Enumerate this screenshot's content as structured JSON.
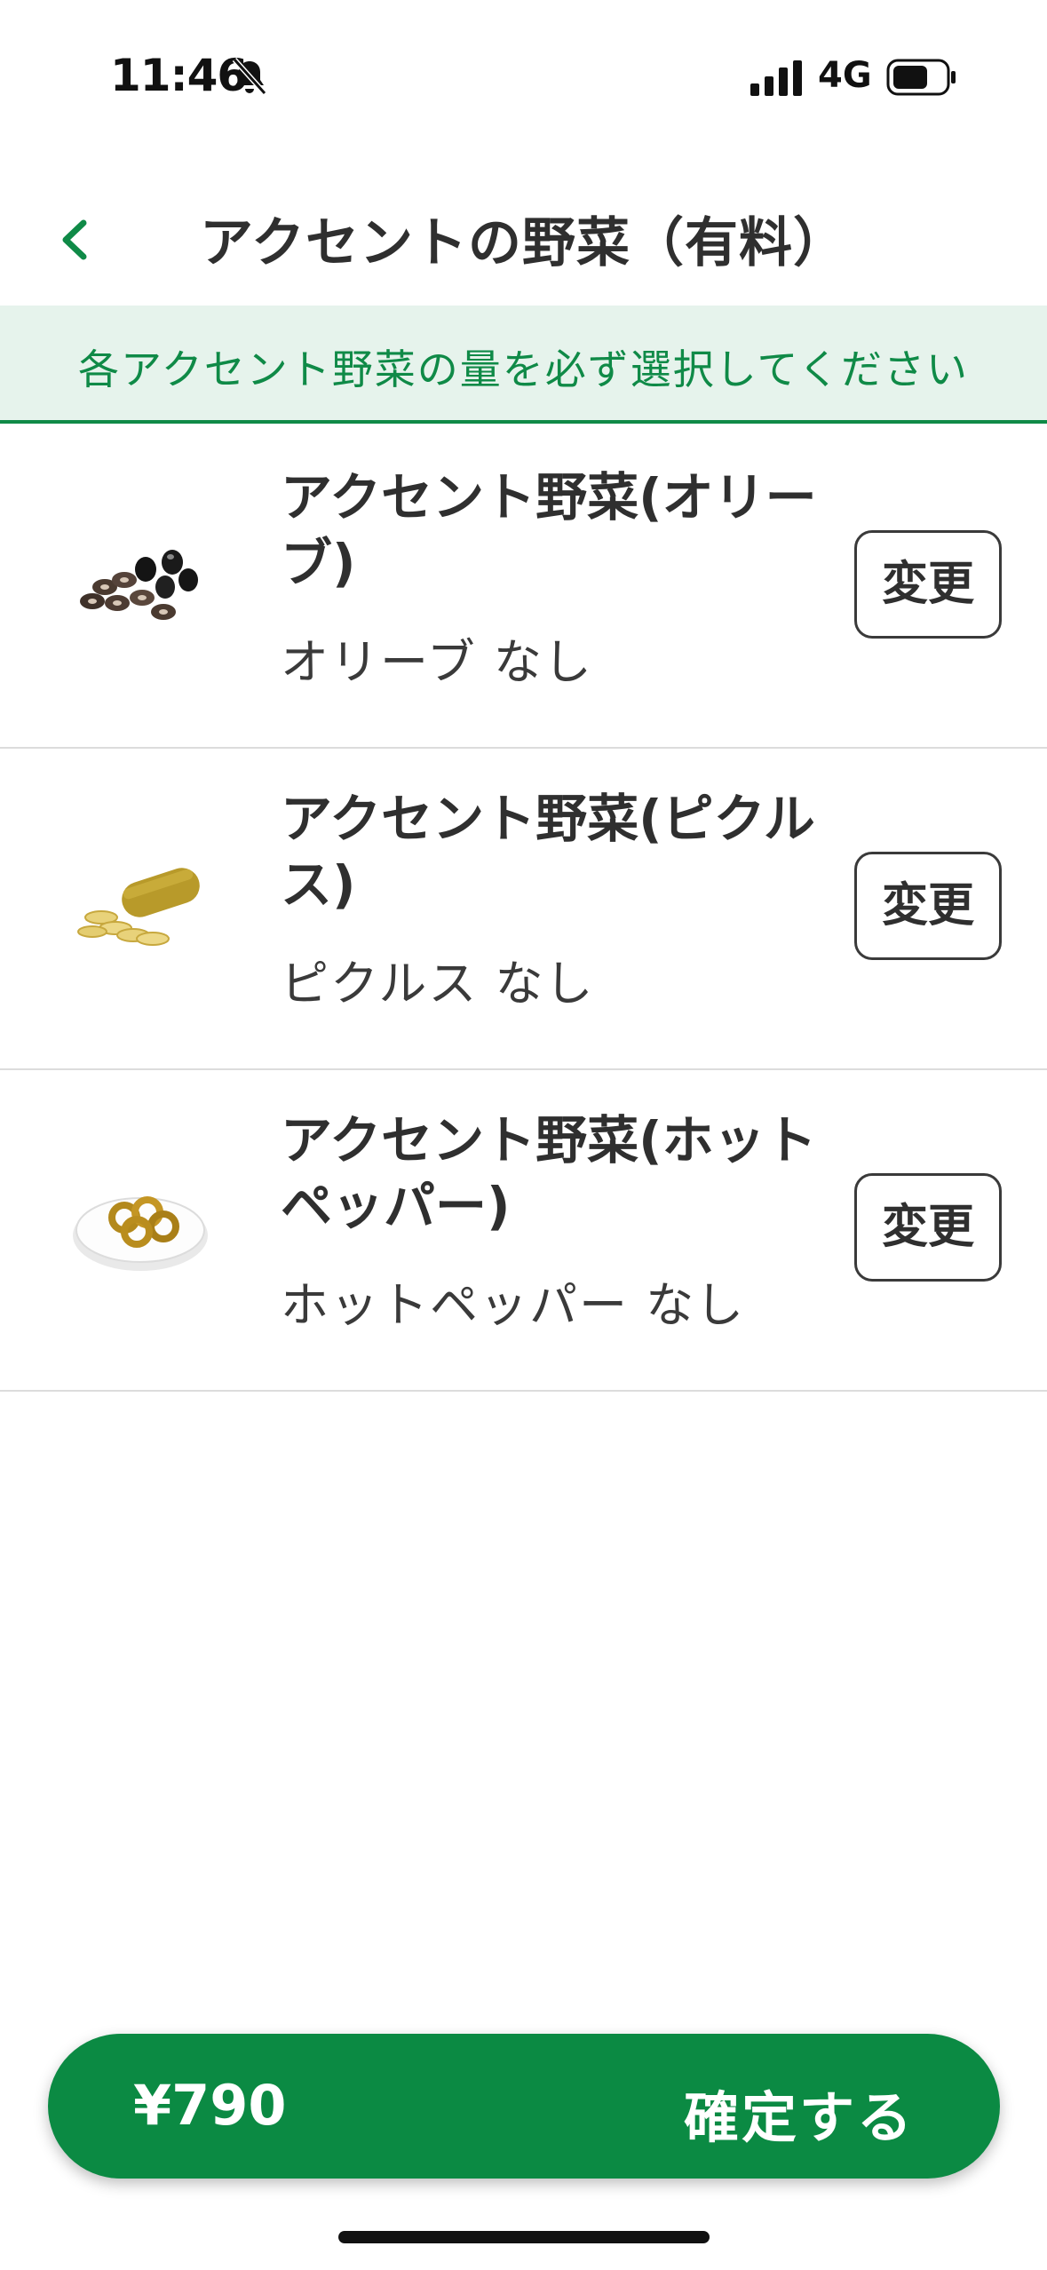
{
  "status_bar": {
    "time": "11:46",
    "network": "4G"
  },
  "header": {
    "title": "アクセントの野菜（有料）"
  },
  "notice": {
    "text": "各アクセント野菜の量を必ず選択してください"
  },
  "items": [
    {
      "name": "アクセント野菜(オリーブ)",
      "value": "オリーブ なし",
      "button_label": "変更",
      "icon": "olive-icon"
    },
    {
      "name": "アクセント野菜(ピクルス)",
      "value": "ピクルス なし",
      "button_label": "変更",
      "icon": "pickles-icon"
    },
    {
      "name": "アクセント野菜(ホットペッパー)",
      "value": "ホットペッパー なし",
      "button_label": "変更",
      "icon": "hot-pepper-icon"
    }
  ],
  "footer": {
    "price": "¥790",
    "confirm_label": "確定する"
  },
  "colors": {
    "brand_green": "#0b8a43",
    "notice_bg": "#e6f3ec",
    "notice_text": "#0f8a47"
  }
}
